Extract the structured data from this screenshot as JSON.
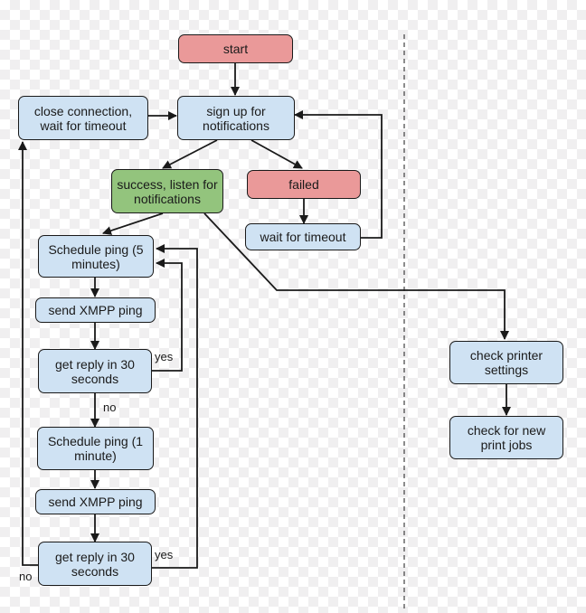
{
  "colors": {
    "process": "#cfe2f3",
    "terminal_error": "#ea9999",
    "success": "#93c47d",
    "line": "#1a1a1a"
  },
  "nodes": {
    "start": "start",
    "sign_up": "sign up for notifications",
    "close_connection": "close connection, wait for timeout",
    "success": "success, listen for notifications",
    "failed": "failed",
    "wait_timeout": "wait for timeout",
    "schedule_5": "Schedule ping (5 minutes)",
    "send_ping_1": "send XMPP ping",
    "reply_1": "get reply in 30 seconds",
    "schedule_1": "Schedule ping (1 minute)",
    "send_ping_2": "send XMPP ping",
    "reply_2": "get reply in 30 seconds",
    "check_settings": "check printer settings",
    "check_jobs": "check for new print jobs"
  },
  "edge_labels": {
    "reply1_yes": "yes",
    "reply1_no": "no",
    "reply2_yes": "yes",
    "reply2_no": "no"
  }
}
